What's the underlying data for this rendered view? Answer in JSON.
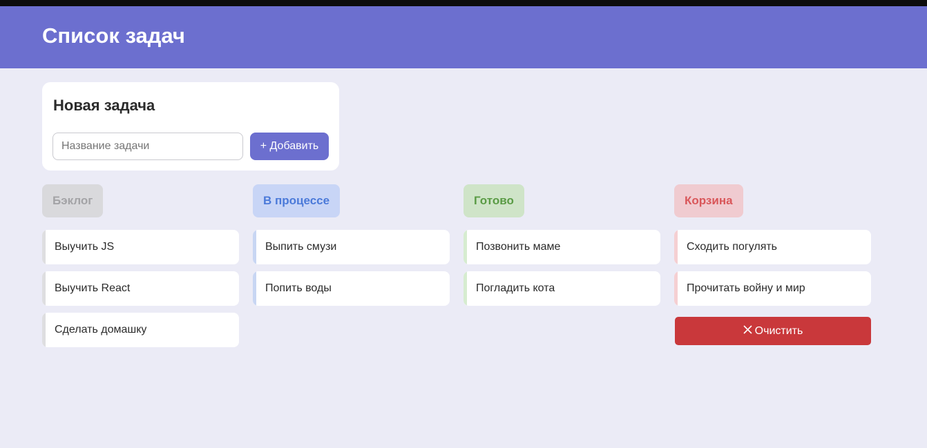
{
  "app": {
    "title": "Список задач"
  },
  "new_task": {
    "heading": "Новая задача",
    "input_value": "",
    "input_placeholder": "Название задачи",
    "add_label": "+ Добавить"
  },
  "columns": [
    {
      "title": "Бэклог",
      "title_color": "#a3a3a6",
      "title_bg": "#d9d9dc",
      "accent": "#dedee0",
      "tasks": [
        "Выучить JS",
        "Выучить React",
        "Сделать домашку"
      ]
    },
    {
      "title": "В процессе",
      "title_color": "#4b7ad9",
      "title_bg": "#c8d5f6",
      "accent": "#c8d6f3",
      "tasks": [
        "Выпить смузи",
        "Попить воды"
      ]
    },
    {
      "title": "Готово",
      "title_color": "#5a9b45",
      "title_bg": "#cfe4c8",
      "accent": "#d6ecd0",
      "tasks": [
        "Позвонить маме",
        "Погладить кота"
      ]
    },
    {
      "title": "Корзина",
      "title_color": "#d9575a",
      "title_bg": "#f0cbd0",
      "accent": "#f5cfd2",
      "tasks": [
        "Сходить погулять",
        "Прочитать войну и мир"
      ]
    }
  ],
  "trash": {
    "clear_label": "Очистить",
    "clear_icon": "close-icon",
    "clear_color": "#c9383b"
  },
  "colors": {
    "header_bg": "#6c6fcf",
    "page_bg": "#ebebf6"
  }
}
